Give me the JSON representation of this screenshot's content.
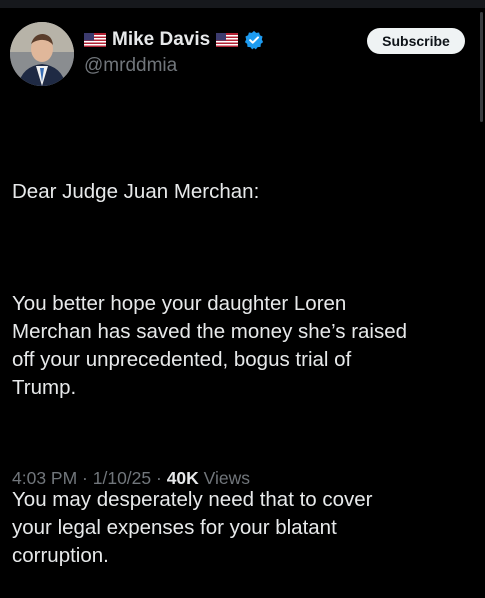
{
  "profile": {
    "name": "Mike Davis",
    "handle": "@mrddmia",
    "verified": true,
    "flag_icon": "us-flag-icon"
  },
  "actions": {
    "subscribe_label": "Subscribe"
  },
  "tweet": {
    "paragraphs": [
      "Dear Judge Juan Merchan:",
      "You better hope your daughter Loren\nMerchan has saved the money she’s raised\noff your unprecedented, bogus trial of\nTrump.",
      "You may desperately need that to cover\nyour legal expenses for your blatant\ncorruption."
    ]
  },
  "meta": {
    "time": "4:03 PM",
    "separator": " · ",
    "date": "1/10/25",
    "views_count": "40K",
    "views_label": " Views"
  },
  "colors": {
    "background": "#000000",
    "text": "#e7e9ea",
    "muted": "#71767b",
    "verified_blue": "#1d9bf0"
  }
}
